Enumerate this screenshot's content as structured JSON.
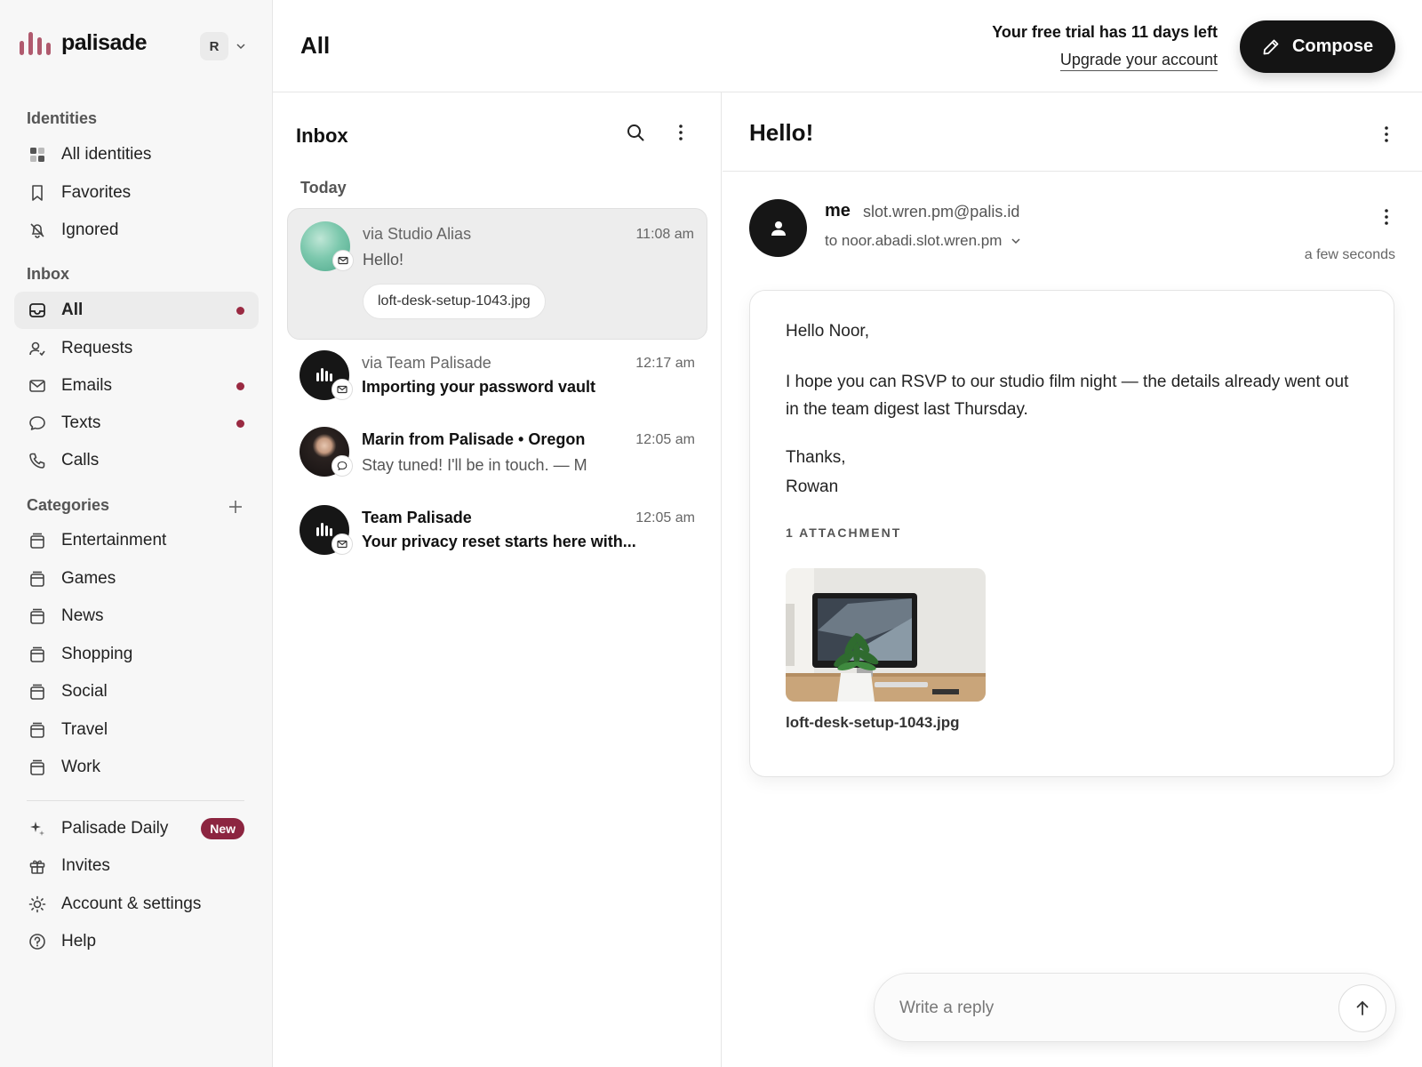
{
  "brand": {
    "name": "palisade"
  },
  "account": {
    "initial": "R"
  },
  "sidebar": {
    "identities_title": "Identities",
    "identities": [
      {
        "label": "All identities",
        "icon": "grid-icon"
      },
      {
        "label": "Favorites",
        "icon": "bookmark-icon"
      },
      {
        "label": "Ignored",
        "icon": "bell-off-icon"
      }
    ],
    "inbox_title": "Inbox",
    "inbox": [
      {
        "label": "All",
        "icon": "inbox-icon",
        "active": true,
        "unread": true
      },
      {
        "label": "Requests",
        "icon": "person-icon",
        "unread": false
      },
      {
        "label": "Emails",
        "icon": "mail-icon",
        "unread": true
      },
      {
        "label": "Texts",
        "icon": "chat-icon",
        "unread": true
      },
      {
        "label": "Calls",
        "icon": "phone-icon",
        "unread": false
      }
    ],
    "categories_title": "Categories",
    "categories": [
      {
        "label": "Entertainment"
      },
      {
        "label": "Games"
      },
      {
        "label": "News"
      },
      {
        "label": "Shopping"
      },
      {
        "label": "Social"
      },
      {
        "label": "Travel"
      },
      {
        "label": "Work"
      }
    ],
    "footer": [
      {
        "label": "Palisade Daily",
        "icon": "sparkle-icon",
        "badge": "New"
      },
      {
        "label": "Invites",
        "icon": "gift-icon"
      },
      {
        "label": "Account & settings",
        "icon": "sun-icon"
      },
      {
        "label": "Help",
        "icon": "help-icon"
      }
    ]
  },
  "header": {
    "title": "All",
    "trial_message": "Your free trial has 11 days left",
    "upgrade_link": "Upgrade your account",
    "compose_label": "Compose"
  },
  "inbox": {
    "title": "Inbox",
    "group_label": "Today",
    "messages": [
      {
        "from": "via Studio Alias",
        "time": "11:08 am",
        "subject": "Hello!",
        "attachment": "loft-desk-setup-1043.jpg",
        "selected": true,
        "channel": "mail-icon"
      },
      {
        "from": "via Team Palisade",
        "time": "12:17 am",
        "subject": "Importing your password vault",
        "channel": "mail-icon"
      },
      {
        "from": "Marin from Palisade • Oregon",
        "time": "12:05 am",
        "subject": "Stay tuned! I'll be in touch. — M",
        "channel": "chat-icon"
      },
      {
        "from": "Team Palisade",
        "time": "12:05 am",
        "subject": "Your privacy reset starts here with...",
        "channel": "mail-icon"
      }
    ]
  },
  "reader": {
    "title": "Hello!",
    "sender": "me",
    "sender_address": "slot.wren.pm@palis.id",
    "to_line": "to noor.abadi.slot.wren.pm",
    "when": "a few seconds",
    "greeting": "Hello Noor,",
    "body": "I hope you can RSVP to our studio film night — the details already went out in the team digest last Thursday.",
    "signoff": "Thanks,",
    "signature": "Rowan",
    "attachments_heading": "1 ATTACHMENT",
    "attachment_name": "loft-desk-setup-1043.jpg",
    "reply_placeholder": "Write a reply"
  },
  "colors": {
    "accent": "#9a2a42",
    "brand_bar": "#b05a6e",
    "compose_bg": "#141414"
  }
}
